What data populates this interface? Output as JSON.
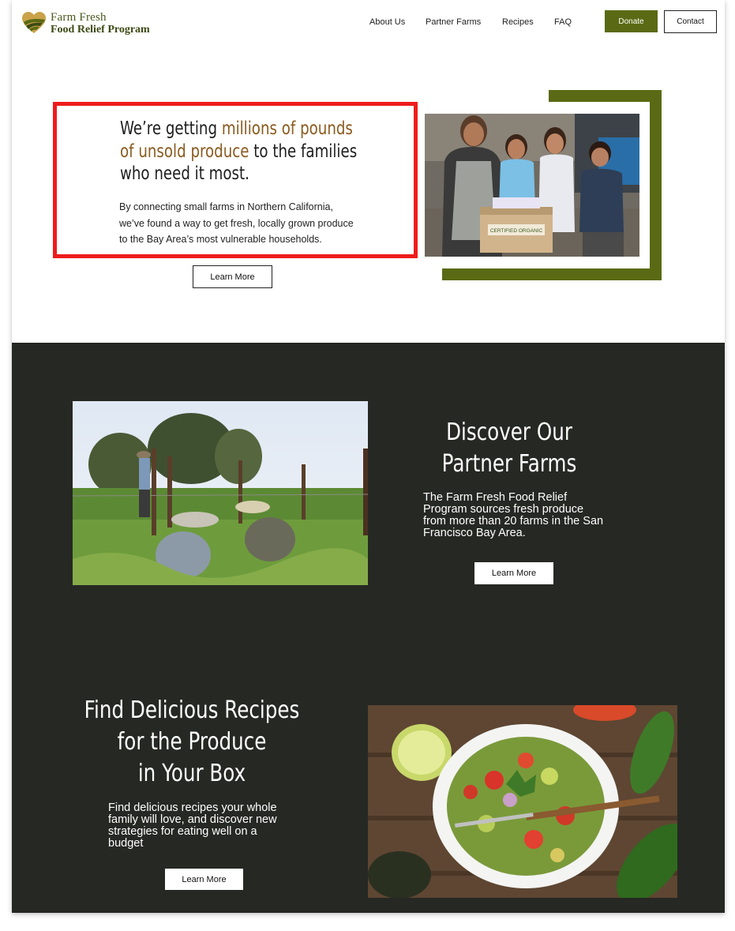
{
  "header": {
    "logo_line1": "Farm Fresh",
    "logo_line2": "Food Relief Program",
    "nav": [
      "About Us",
      "Partner Farms",
      "Recipes",
      "FAQ"
    ],
    "donate_label": "Donate",
    "contact_label": "Contact"
  },
  "hero": {
    "headline_pre": "We’re getting ",
    "headline_accent_1": "millions of pounds",
    "headline_accent_2": "of unsold produce",
    "headline_post_1": " to the families",
    "headline_post_2": "who need it most.",
    "body_1": "By connecting small farms in Northern California,",
    "body_2": "we’ve found a way to get fresh, locally grown produce",
    "body_3": "to the Bay Area’s most vulnerable households.",
    "button_label": "Learn More",
    "box_label": "CERTIFIED ORGANIC"
  },
  "farms": {
    "title_1": "Discover Our",
    "title_2": "Partner Farms",
    "body_1": "The Farm Fresh Food Relief",
    "body_2": "Program sources fresh produce",
    "body_3": "from more than 20 farms in the San",
    "body_4": "Francisco Bay Area.",
    "button_label": "Learn More"
  },
  "recipes": {
    "title_1": "Find Delicious Recipes",
    "title_2": "for the Produce",
    "title_3": "in Your Box",
    "body_1": "Find delicious recipes your whole",
    "body_2": "family will love, and discover new",
    "body_3": "strategies for eating well on a",
    "body_4": "budget",
    "button_label": "Learn More"
  },
  "colors": {
    "accent_green": "#5a6a14",
    "accent_brown": "#8b5a1e",
    "highlight_red": "#ee1c1c",
    "dark_bg": "#262823"
  },
  "icons": [
    "heart-field-logo-icon"
  ]
}
